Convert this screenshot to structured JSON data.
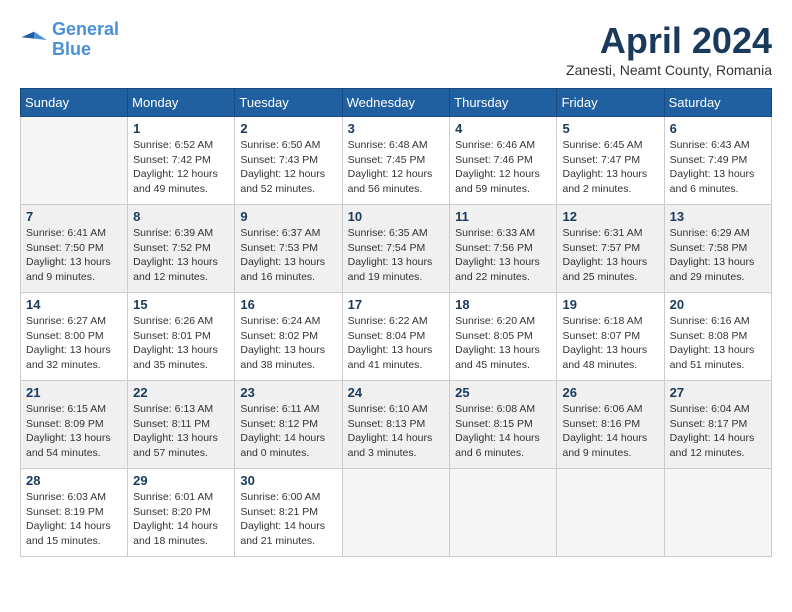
{
  "logo": {
    "line1": "General",
    "line2": "Blue"
  },
  "title": "April 2024",
  "subtitle": "Zanesti, Neamt County, Romania",
  "days_header": [
    "Sunday",
    "Monday",
    "Tuesday",
    "Wednesday",
    "Thursday",
    "Friday",
    "Saturday"
  ],
  "weeks": [
    [
      {
        "num": "",
        "sunrise": "",
        "sunset": "",
        "daylight": ""
      },
      {
        "num": "1",
        "sunrise": "Sunrise: 6:52 AM",
        "sunset": "Sunset: 7:42 PM",
        "daylight": "Daylight: 12 hours and 49 minutes."
      },
      {
        "num": "2",
        "sunrise": "Sunrise: 6:50 AM",
        "sunset": "Sunset: 7:43 PM",
        "daylight": "Daylight: 12 hours and 52 minutes."
      },
      {
        "num": "3",
        "sunrise": "Sunrise: 6:48 AM",
        "sunset": "Sunset: 7:45 PM",
        "daylight": "Daylight: 12 hours and 56 minutes."
      },
      {
        "num": "4",
        "sunrise": "Sunrise: 6:46 AM",
        "sunset": "Sunset: 7:46 PM",
        "daylight": "Daylight: 12 hours and 59 minutes."
      },
      {
        "num": "5",
        "sunrise": "Sunrise: 6:45 AM",
        "sunset": "Sunset: 7:47 PM",
        "daylight": "Daylight: 13 hours and 2 minutes."
      },
      {
        "num": "6",
        "sunrise": "Sunrise: 6:43 AM",
        "sunset": "Sunset: 7:49 PM",
        "daylight": "Daylight: 13 hours and 6 minutes."
      }
    ],
    [
      {
        "num": "7",
        "sunrise": "Sunrise: 6:41 AM",
        "sunset": "Sunset: 7:50 PM",
        "daylight": "Daylight: 13 hours and 9 minutes."
      },
      {
        "num": "8",
        "sunrise": "Sunrise: 6:39 AM",
        "sunset": "Sunset: 7:52 PM",
        "daylight": "Daylight: 13 hours and 12 minutes."
      },
      {
        "num": "9",
        "sunrise": "Sunrise: 6:37 AM",
        "sunset": "Sunset: 7:53 PM",
        "daylight": "Daylight: 13 hours and 16 minutes."
      },
      {
        "num": "10",
        "sunrise": "Sunrise: 6:35 AM",
        "sunset": "Sunset: 7:54 PM",
        "daylight": "Daylight: 13 hours and 19 minutes."
      },
      {
        "num": "11",
        "sunrise": "Sunrise: 6:33 AM",
        "sunset": "Sunset: 7:56 PM",
        "daylight": "Daylight: 13 hours and 22 minutes."
      },
      {
        "num": "12",
        "sunrise": "Sunrise: 6:31 AM",
        "sunset": "Sunset: 7:57 PM",
        "daylight": "Daylight: 13 hours and 25 minutes."
      },
      {
        "num": "13",
        "sunrise": "Sunrise: 6:29 AM",
        "sunset": "Sunset: 7:58 PM",
        "daylight": "Daylight: 13 hours and 29 minutes."
      }
    ],
    [
      {
        "num": "14",
        "sunrise": "Sunrise: 6:27 AM",
        "sunset": "Sunset: 8:00 PM",
        "daylight": "Daylight: 13 hours and 32 minutes."
      },
      {
        "num": "15",
        "sunrise": "Sunrise: 6:26 AM",
        "sunset": "Sunset: 8:01 PM",
        "daylight": "Daylight: 13 hours and 35 minutes."
      },
      {
        "num": "16",
        "sunrise": "Sunrise: 6:24 AM",
        "sunset": "Sunset: 8:02 PM",
        "daylight": "Daylight: 13 hours and 38 minutes."
      },
      {
        "num": "17",
        "sunrise": "Sunrise: 6:22 AM",
        "sunset": "Sunset: 8:04 PM",
        "daylight": "Daylight: 13 hours and 41 minutes."
      },
      {
        "num": "18",
        "sunrise": "Sunrise: 6:20 AM",
        "sunset": "Sunset: 8:05 PM",
        "daylight": "Daylight: 13 hours and 45 minutes."
      },
      {
        "num": "19",
        "sunrise": "Sunrise: 6:18 AM",
        "sunset": "Sunset: 8:07 PM",
        "daylight": "Daylight: 13 hours and 48 minutes."
      },
      {
        "num": "20",
        "sunrise": "Sunrise: 6:16 AM",
        "sunset": "Sunset: 8:08 PM",
        "daylight": "Daylight: 13 hours and 51 minutes."
      }
    ],
    [
      {
        "num": "21",
        "sunrise": "Sunrise: 6:15 AM",
        "sunset": "Sunset: 8:09 PM",
        "daylight": "Daylight: 13 hours and 54 minutes."
      },
      {
        "num": "22",
        "sunrise": "Sunrise: 6:13 AM",
        "sunset": "Sunset: 8:11 PM",
        "daylight": "Daylight: 13 hours and 57 minutes."
      },
      {
        "num": "23",
        "sunrise": "Sunrise: 6:11 AM",
        "sunset": "Sunset: 8:12 PM",
        "daylight": "Daylight: 14 hours and 0 minutes."
      },
      {
        "num": "24",
        "sunrise": "Sunrise: 6:10 AM",
        "sunset": "Sunset: 8:13 PM",
        "daylight": "Daylight: 14 hours and 3 minutes."
      },
      {
        "num": "25",
        "sunrise": "Sunrise: 6:08 AM",
        "sunset": "Sunset: 8:15 PM",
        "daylight": "Daylight: 14 hours and 6 minutes."
      },
      {
        "num": "26",
        "sunrise": "Sunrise: 6:06 AM",
        "sunset": "Sunset: 8:16 PM",
        "daylight": "Daylight: 14 hours and 9 minutes."
      },
      {
        "num": "27",
        "sunrise": "Sunrise: 6:04 AM",
        "sunset": "Sunset: 8:17 PM",
        "daylight": "Daylight: 14 hours and 12 minutes."
      }
    ],
    [
      {
        "num": "28",
        "sunrise": "Sunrise: 6:03 AM",
        "sunset": "Sunset: 8:19 PM",
        "daylight": "Daylight: 14 hours and 15 minutes."
      },
      {
        "num": "29",
        "sunrise": "Sunrise: 6:01 AM",
        "sunset": "Sunset: 8:20 PM",
        "daylight": "Daylight: 14 hours and 18 minutes."
      },
      {
        "num": "30",
        "sunrise": "Sunrise: 6:00 AM",
        "sunset": "Sunset: 8:21 PM",
        "daylight": "Daylight: 14 hours and 21 minutes."
      },
      {
        "num": "",
        "sunrise": "",
        "sunset": "",
        "daylight": ""
      },
      {
        "num": "",
        "sunrise": "",
        "sunset": "",
        "daylight": ""
      },
      {
        "num": "",
        "sunrise": "",
        "sunset": "",
        "daylight": ""
      },
      {
        "num": "",
        "sunrise": "",
        "sunset": "",
        "daylight": ""
      }
    ]
  ]
}
